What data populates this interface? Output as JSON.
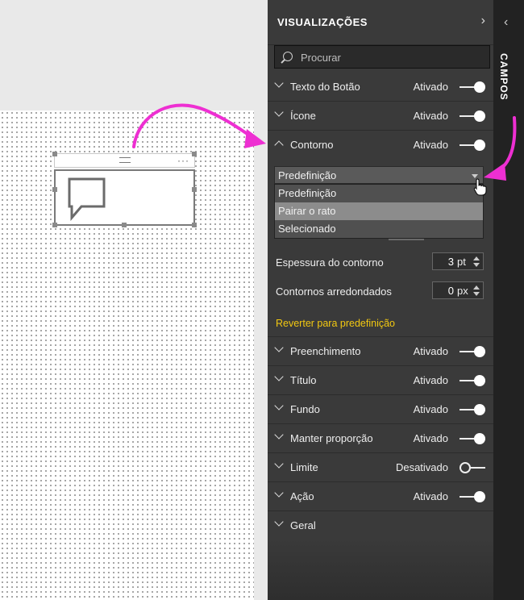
{
  "visualizations": {
    "title": "VISUALIZAÇÕES",
    "collapse_icon": "chevron-right-icon",
    "search_placeholder": "Procurar",
    "sections_top": [
      {
        "label": "Texto do Botão",
        "status": "Ativado",
        "on": true
      },
      {
        "label": "Ícone",
        "status": "Ativado",
        "on": true
      },
      {
        "label": "Contorno",
        "status": "Ativado",
        "on": true,
        "expanded": true
      }
    ],
    "state_dropdown": {
      "selected": "Predefinição",
      "options": [
        "Predefinição",
        "Pairar o rato",
        "Selecionado"
      ],
      "hovered": "Pairar o rato"
    },
    "outline_weight": {
      "label": "Espessura do contorno",
      "value": "3",
      "unit": "pt"
    },
    "rounded_edges": {
      "label": "Contornos arredondados",
      "value": "0",
      "unit": "px"
    },
    "revert_label": "Reverter para predefinição",
    "sections_bottom": [
      {
        "label": "Preenchimento",
        "status": "Ativado",
        "on": true
      },
      {
        "label": "Título",
        "status": "Ativado",
        "on": true
      },
      {
        "label": "Fundo",
        "status": "Ativado",
        "on": true
      },
      {
        "label": "Manter proporção",
        "status": "Ativado",
        "on": true
      },
      {
        "label": "Limite",
        "status": "Desativado",
        "on": false
      },
      {
        "label": "Ação",
        "status": "Ativado",
        "on": true
      },
      {
        "label": "Geral",
        "status": "",
        "on": null
      }
    ]
  },
  "fields": {
    "label": "CAMPOS",
    "expand_icon": "chevron-left-icon"
  },
  "colors": {
    "pane_bg": "#3a3a3a",
    "accent_link": "#f2c811",
    "annotation_arrow": "#ee2fd2"
  }
}
